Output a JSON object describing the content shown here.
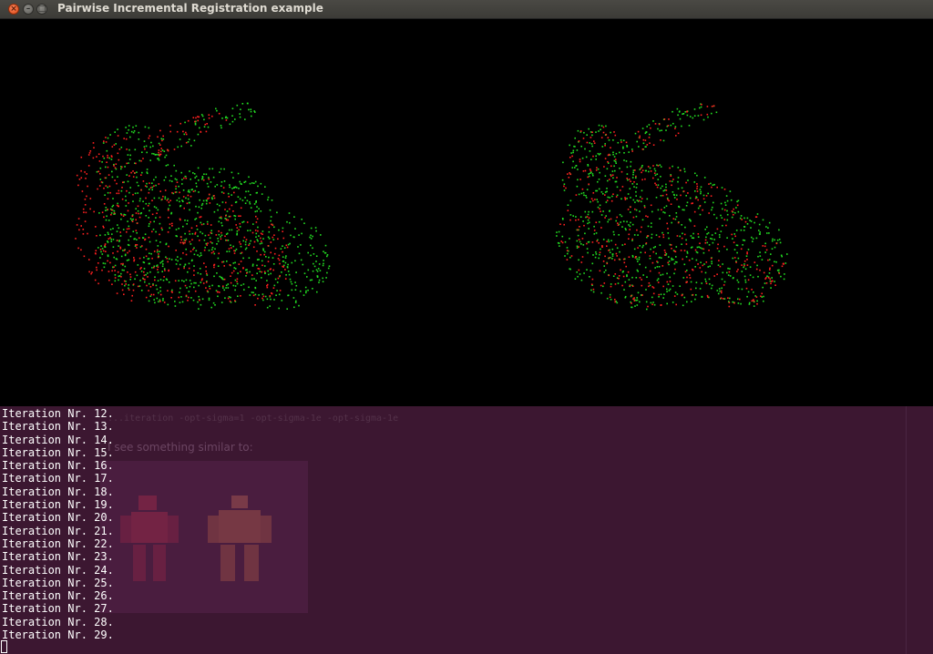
{
  "window": {
    "title": "Pairwise Incremental Registration example",
    "close_glyph": "×",
    "minimize_glyph": "–",
    "maximize_glyph": "□"
  },
  "viewer": {
    "background": "#000000",
    "source_color": "#ff2020",
    "target_color": "#22dd22"
  },
  "background_page": {
    "command_text": "...iteration -opt-sigma=1 -opt-sigma-1e -opt-sigma-1e",
    "see_text": "I see something similar to:"
  },
  "terminal": {
    "lines": [
      "Iteration Nr. 12.",
      "Iteration Nr. 13.",
      "Iteration Nr. 14.",
      "Iteration Nr. 15.",
      "Iteration Nr. 16.",
      "Iteration Nr. 17.",
      "Iteration Nr. 18.",
      "Iteration Nr. 19.",
      "Iteration Nr. 20.",
      "Iteration Nr. 21.",
      "Iteration Nr. 22.",
      "Iteration Nr. 23.",
      "Iteration Nr. 24.",
      "Iteration Nr. 25.",
      "Iteration Nr. 26.",
      "Iteration Nr. 27.",
      "Iteration Nr. 28.",
      "Iteration Nr. 29."
    ]
  }
}
